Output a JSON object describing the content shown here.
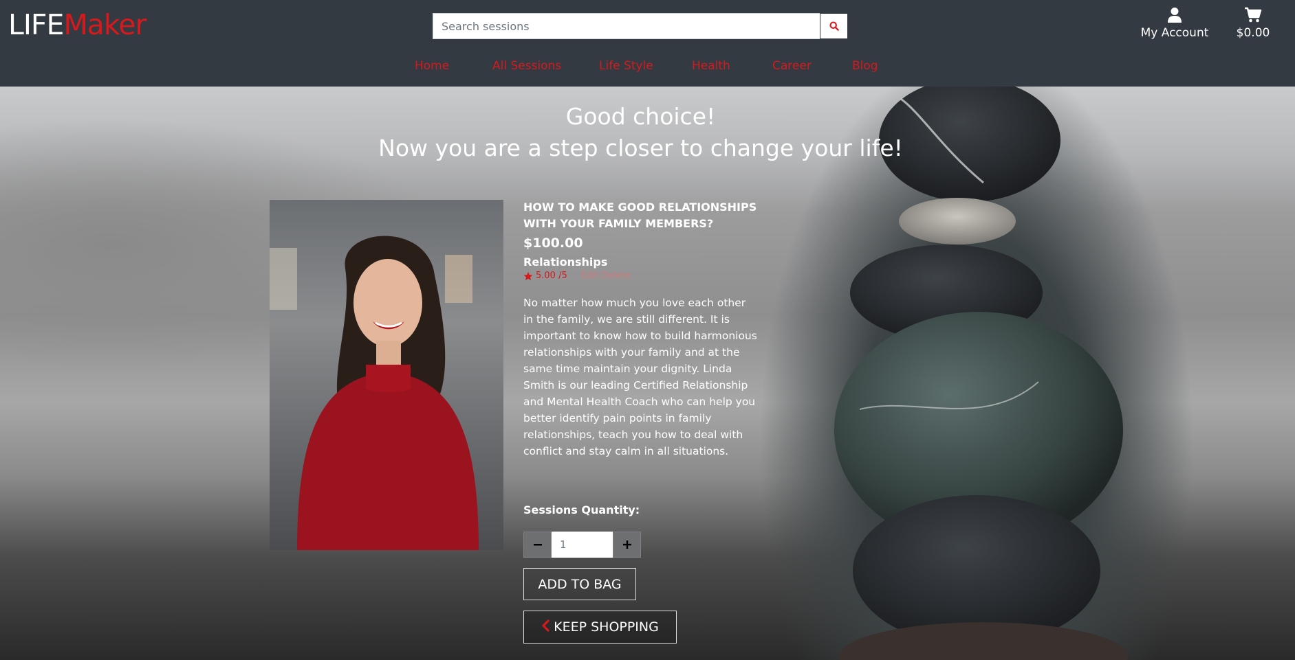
{
  "brand": {
    "part1": "LIFE",
    "part2": "Maker"
  },
  "search": {
    "placeholder": "Search sessions"
  },
  "account": {
    "label": "My Account"
  },
  "cart": {
    "total": "$0.00"
  },
  "nav": [
    {
      "label": "Home"
    },
    {
      "label": "All Sessions"
    },
    {
      "label": "Life Style"
    },
    {
      "label": "Health"
    },
    {
      "label": "Career"
    },
    {
      "label": "Blog"
    }
  ],
  "hero": {
    "line1": "Good choice!",
    "line2": "Now you are a step closer to change your life!"
  },
  "product": {
    "title": "HOW TO MAKE GOOD RELATIONSHIPS WITH YOUR FAMILY MEMBERS?",
    "price": "$100.00",
    "category": "Relationships",
    "rating": "5.00 /5",
    "edit_label": "Edit",
    "delete_label": "Delete",
    "description": "No matter how much you love each other in the family, we are still different. It is important to know how to build harmonious relationships with your family and at the same time maintain your dignity. Linda Smith is our leading Certified Relationship and Mental Health Coach who can help you better identify pain points in family relationships, teach you how to deal with conflict and stay calm in all situations."
  },
  "quantity": {
    "label": "Sessions Quantity:",
    "value": "1",
    "minus": "−",
    "plus": "+"
  },
  "buttons": {
    "add_to_bag": "ADD TO BAG",
    "keep_shopping": "KEEP SHOPPING"
  },
  "colors": {
    "header_bg": "#343a42",
    "accent": "#d6191d"
  },
  "icons": {
    "search": "search-icon",
    "account": "user-icon",
    "cart": "shopping-cart-icon",
    "star": "star-icon",
    "back": "chevron-left-icon"
  }
}
